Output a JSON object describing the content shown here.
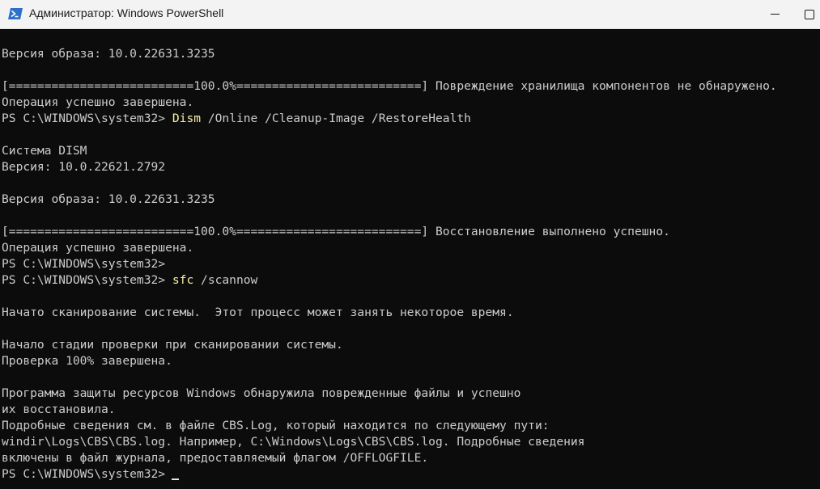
{
  "window": {
    "title": "Администратор: Windows PowerShell"
  },
  "icons": {
    "app": "powershell-icon",
    "minimize": "minimize-icon",
    "maximize": "maximize-icon"
  },
  "colors": {
    "background": "#0c0c0c",
    "text": "#cccccc",
    "command": "#f9f1a5",
    "titlebar": "#f3f3f3"
  },
  "terminal": {
    "lines": [
      "Версия образа: 10.0.22631.3235",
      "",
      "[==========================100.0%==========================] Повреждение хранилища компонентов не обнаружено.",
      "Операция успешно завершена.",
      "",
      "",
      "Система DISM",
      "Версия: 10.0.22621.2792",
      "",
      "Версия образа: 10.0.22631.3235",
      "",
      "[==========================100.0%==========================] Восстановление выполнено успешно.",
      "Операция успешно завершена.",
      "PS C:\\WINDOWS\\system32>",
      "",
      "",
      "Начато сканирование системы.  Этот процесс может занять некоторое время.",
      "",
      "Начало стадии проверки при сканировании системы.",
      "Проверка 100% завершена.",
      "",
      "Программа защиты ресурсов Windows обнаружила поврежденные файлы и успешно",
      "их восстановила.",
      "Подробные сведения см. в файле CBS.Log, который находится по следующему пути:",
      "windir\\Logs\\CBS\\CBS.log. Например, C:\\Windows\\Logs\\CBS\\CBS.log. Подробные сведения",
      "включены в файл журнала, предоставляемый флагом /OFFLOGFILE."
    ],
    "prompt": "PS C:\\WINDOWS\\system32>",
    "command1": {
      "name": "Dism",
      "args": " /Online /Cleanup-Image /RestoreHealth"
    },
    "command2": {
      "name": "sfc",
      "args": " /scannow"
    }
  }
}
